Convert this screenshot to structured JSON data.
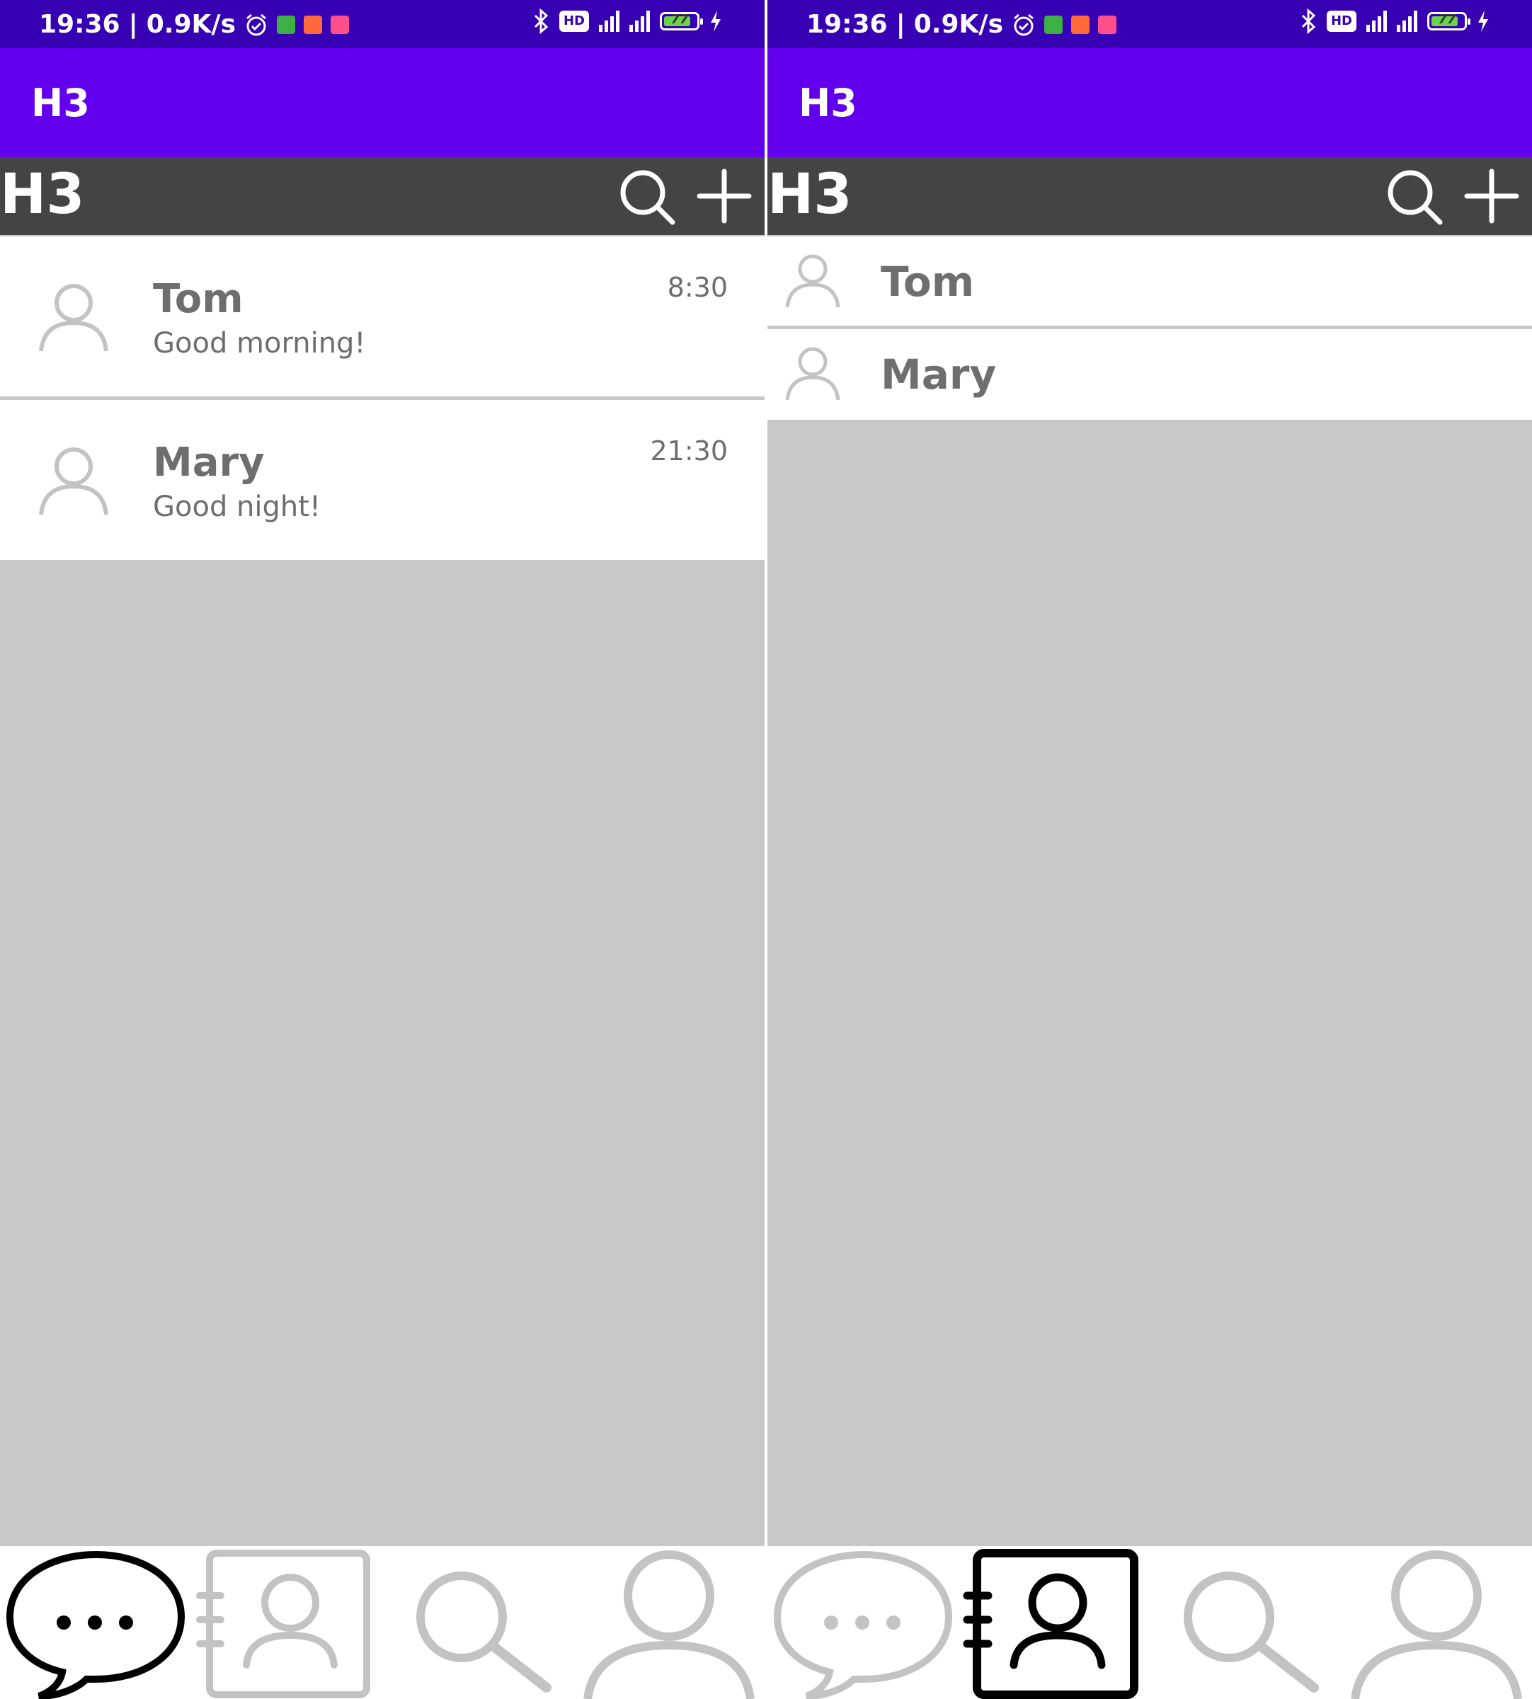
{
  "screens": [
    {
      "status": {
        "time": "19:36",
        "speed": "0.9K/s",
        "battery": "77"
      },
      "appbar": {
        "title": "H3"
      },
      "toolbar": {
        "title": "H3"
      },
      "chats": [
        {
          "name": "Tom",
          "message": "Good morning!",
          "time": "8:30"
        },
        {
          "name": "Mary",
          "message": "Good night!",
          "time": "21:30"
        }
      ],
      "active_tab": "chats"
    },
    {
      "status": {
        "time": "19:36",
        "speed": "0.9K/s",
        "battery": "77"
      },
      "appbar": {
        "title": "H3"
      },
      "toolbar": {
        "title": "H3"
      },
      "contacts": [
        {
          "name": "Tom"
        },
        {
          "name": "Mary"
        }
      ],
      "active_tab": "contacts"
    }
  ],
  "bottom_nav": {
    "tabs": [
      {
        "id": "chats",
        "icon": "chat-bubble-icon"
      },
      {
        "id": "contacts",
        "icon": "contact-book-icon"
      },
      {
        "id": "discover",
        "icon": "search-icon"
      },
      {
        "id": "me",
        "icon": "person-icon"
      }
    ]
  },
  "colors": {
    "status_bar": "#3700b3",
    "app_bar": "#6200ee",
    "toolbar": "#444444",
    "background": "#c8c8c8",
    "text": "#6e6e6e",
    "icon_inactive": "#c3c3c3",
    "icon_active": "#000000"
  }
}
